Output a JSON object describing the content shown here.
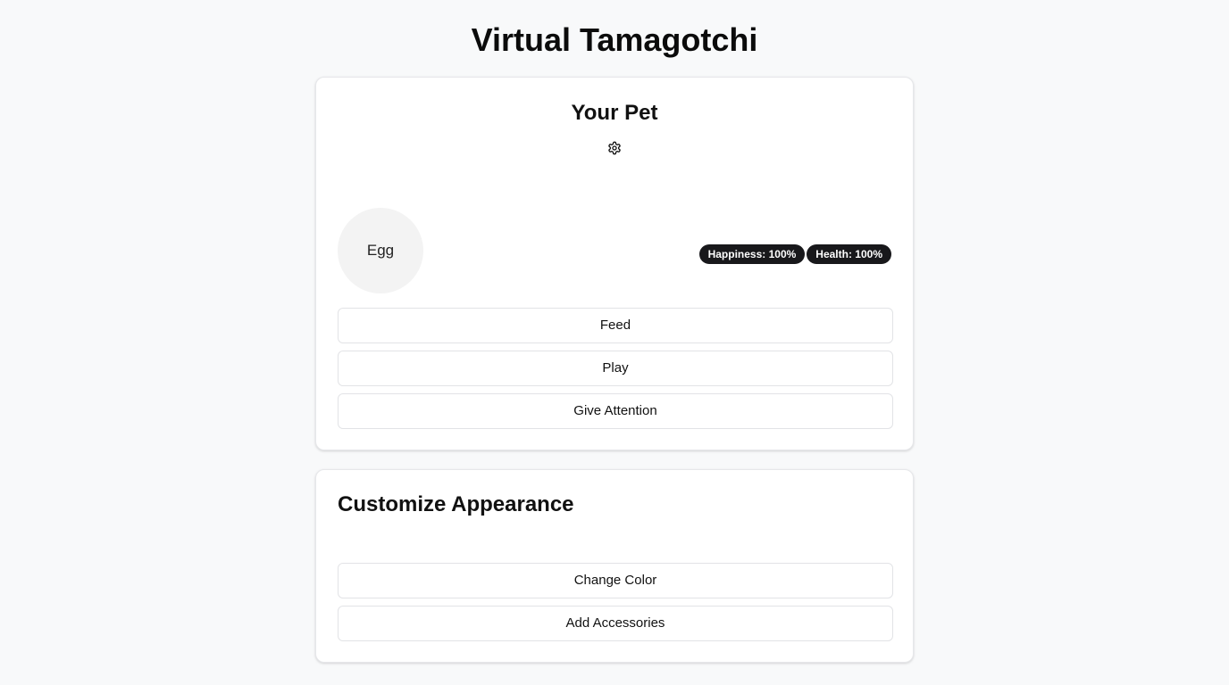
{
  "app": {
    "title": "Virtual Tamagotchi"
  },
  "pet_card": {
    "title": "Your Pet",
    "settings_icon": "gear-icon",
    "pet_stage": "Egg",
    "stats": {
      "happiness": "Happiness: 100%",
      "health": "Health: 100%"
    },
    "actions": {
      "feed": "Feed",
      "play": "Play",
      "attention": "Give Attention"
    }
  },
  "customize_card": {
    "title": "Customize Appearance",
    "actions": {
      "change_color": "Change Color",
      "add_accessories": "Add Accessories"
    }
  },
  "colors": {
    "background": "#f8f9fa",
    "card": "#ffffff",
    "badge": "#18181b",
    "avatar": "#f3f3f3"
  }
}
